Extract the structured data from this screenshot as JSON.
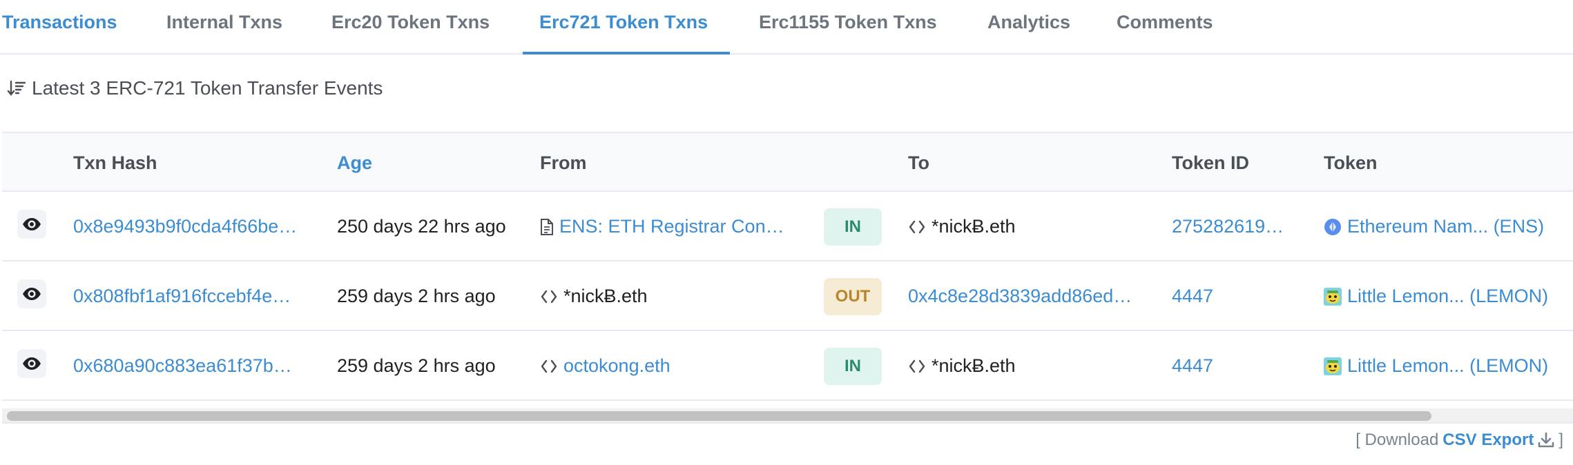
{
  "tabs": [
    {
      "label": "Transactions"
    },
    {
      "label": "Internal Txns"
    },
    {
      "label": "Erc20 Token Txns"
    },
    {
      "label": "Erc721 Token Txns",
      "active": true
    },
    {
      "label": "Erc1155 Token Txns"
    },
    {
      "label": "Analytics"
    },
    {
      "label": "Comments"
    }
  ],
  "heading": {
    "icon": "sort-descending-icon",
    "text": "Latest 3 ERC-721 Token Transfer Events"
  },
  "table": {
    "columns": {
      "txn_hash": "Txn Hash",
      "age": "Age",
      "from": "From",
      "to": "To",
      "token_id": "Token ID",
      "token": "Token"
    },
    "rows": [
      {
        "txn_hash": "0x8e9493b9f0cda4f66be…",
        "age": "250 days 22 hrs ago",
        "from": "ENS: ETH Registrar Con…",
        "from_icon": "contract-doc-icon",
        "from_link": true,
        "direction": "IN",
        "to": "*nickɃ.eth",
        "to_icon": "code-brackets-icon",
        "to_link": false,
        "token_id": "275282619…",
        "token": "Ethereum Nam... (ENS)",
        "token_icon": "ens-logo-icon"
      },
      {
        "txn_hash": "0x808fbf1af916fccebf4e…",
        "age": "259 days 2 hrs ago",
        "from": "*nickɃ.eth",
        "from_icon": "code-brackets-icon",
        "from_link": false,
        "direction": "OUT",
        "to": "0x4c8e28d3839add86ed…",
        "to_icon": "",
        "to_link": true,
        "token_id": "4447",
        "token": "Little Lemon... (LEMON)",
        "token_icon": "lemon-friend-icon"
      },
      {
        "txn_hash": "0x680a90c883ea61f37b…",
        "age": "259 days 2 hrs ago",
        "from": "octokong.eth",
        "from_icon": "code-brackets-icon",
        "from_link": true,
        "direction": "IN",
        "to": "*nickɃ.eth",
        "to_icon": "code-brackets-icon",
        "to_link": false,
        "token_id": "4447",
        "token": "Little Lemon... (LEMON)",
        "token_icon": "lemon-friend-icon"
      }
    ]
  },
  "footer": {
    "prefix": "[ Download",
    "link": "CSV Export",
    "suffix": "]",
    "icon": "download-icon"
  },
  "colors": {
    "link": "#3c8cd2",
    "in_badge_bg": "#dff4ee",
    "in_badge_text": "#2a8a6b",
    "out_badge_bg": "#f6ebd5",
    "out_badge_text": "#b8862a",
    "header_bg": "#f8f9fa"
  }
}
